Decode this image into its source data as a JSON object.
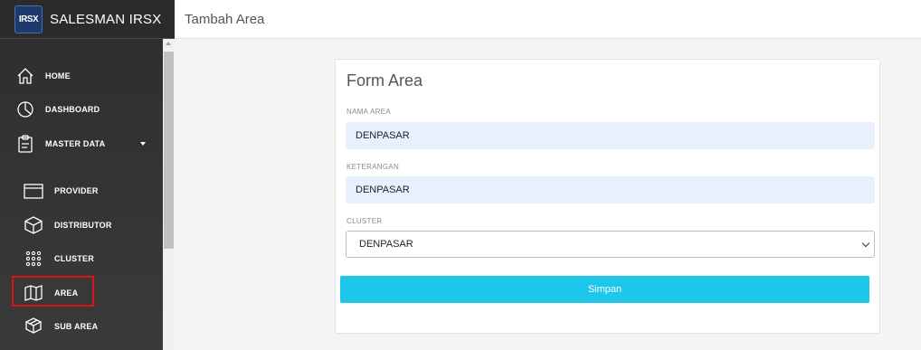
{
  "app": {
    "logo_text": "IRSX",
    "title": "SALESMAN IRSX"
  },
  "header": {
    "title": "Tambah Area"
  },
  "sidebar": {
    "items": [
      {
        "label": "HOME",
        "icon": "home-icon"
      },
      {
        "label": "DASHBOARD",
        "icon": "pie-chart-icon"
      },
      {
        "label": "MASTER DATA",
        "icon": "clipboard-icon",
        "expanded": true
      },
      {
        "label": "PROVIDER",
        "icon": "browser-window-icon"
      },
      {
        "label": "DISTRIBUTOR",
        "icon": "cube-icon"
      },
      {
        "label": "CLUSTER",
        "icon": "dot-grid-icon"
      },
      {
        "label": "AREA",
        "icon": "map-icon",
        "active": true
      },
      {
        "label": "SUB AREA",
        "icon": "boxes-icon"
      }
    ]
  },
  "form": {
    "title": "Form Area",
    "nama_area": {
      "label": "NAMA AREA",
      "value": "DENPASAR"
    },
    "keterangan": {
      "label": "KETERANGAN",
      "value": "DENPASAR"
    },
    "cluster": {
      "label": "CLUSTER",
      "selected": "DENPASAR"
    },
    "submit_label": "Simpan"
  },
  "colors": {
    "sidebar_bg": "#2d2d2d",
    "primary_button": "#1ec6ea",
    "input_autofill_bg": "#e8f0fe",
    "highlight_border": "#e0101a"
  }
}
